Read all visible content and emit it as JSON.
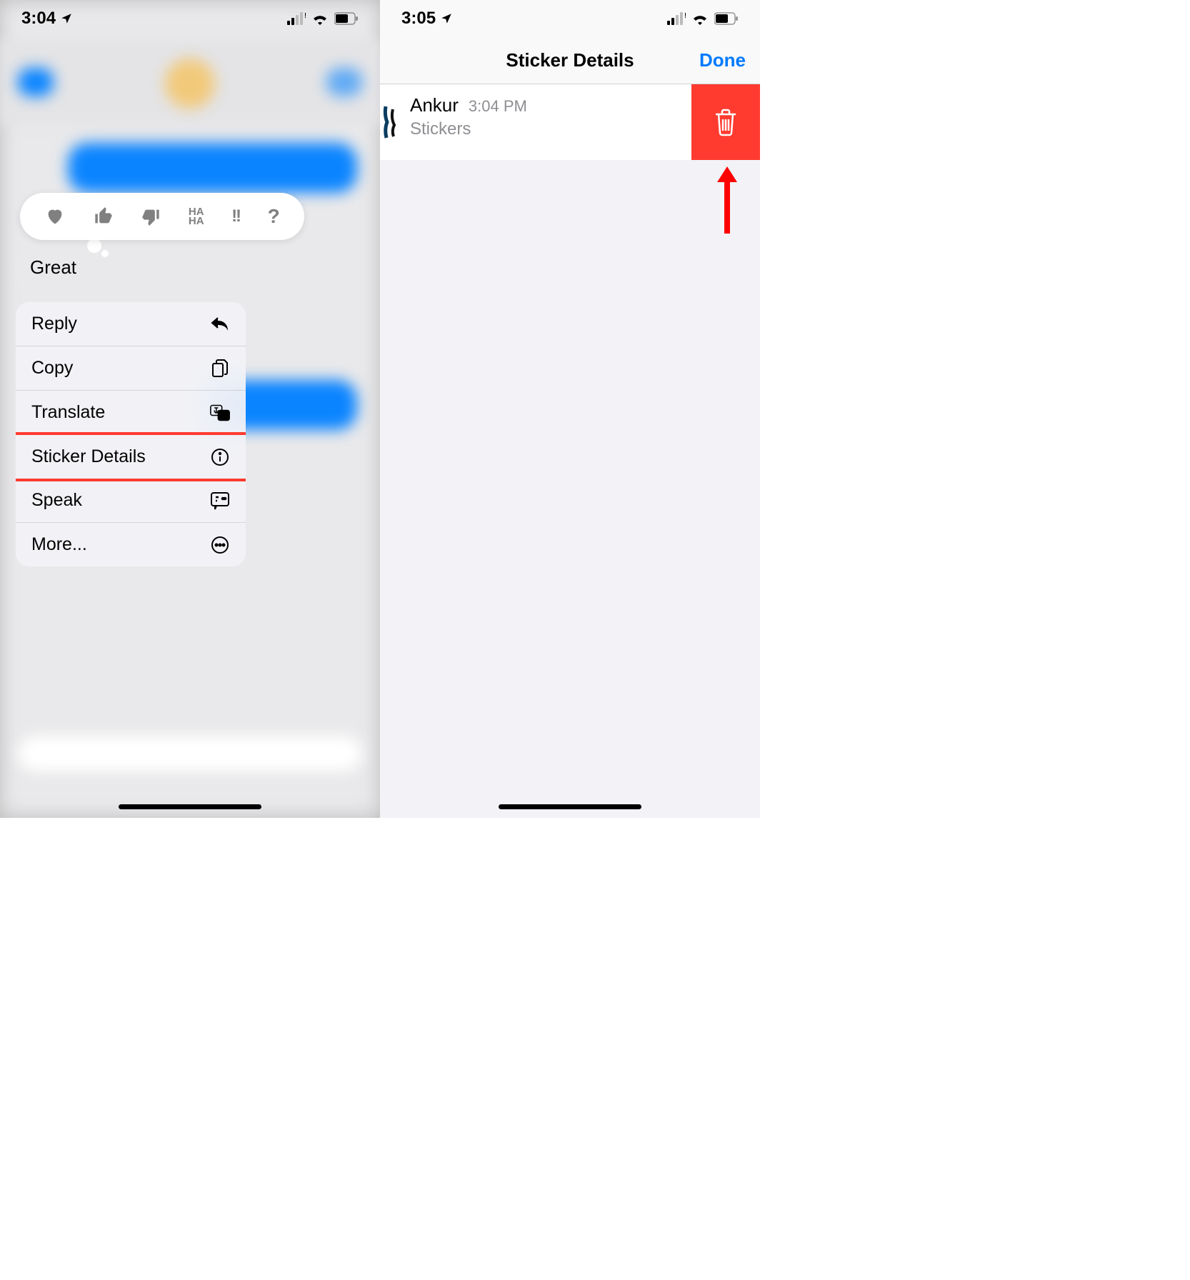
{
  "left": {
    "status": {
      "time": "3:04"
    },
    "message": {
      "text": "Great"
    },
    "menu": {
      "reply": "Reply",
      "copy": "Copy",
      "translate": "Translate",
      "sticker_details": "Sticker Details",
      "speak": "Speak",
      "more": "More..."
    }
  },
  "right": {
    "status": {
      "time": "3:05"
    },
    "header": {
      "title": "Sticker Details",
      "done": "Done"
    },
    "row": {
      "name": "Ankur",
      "time": "3:04 PM",
      "subtitle": "Stickers"
    }
  }
}
